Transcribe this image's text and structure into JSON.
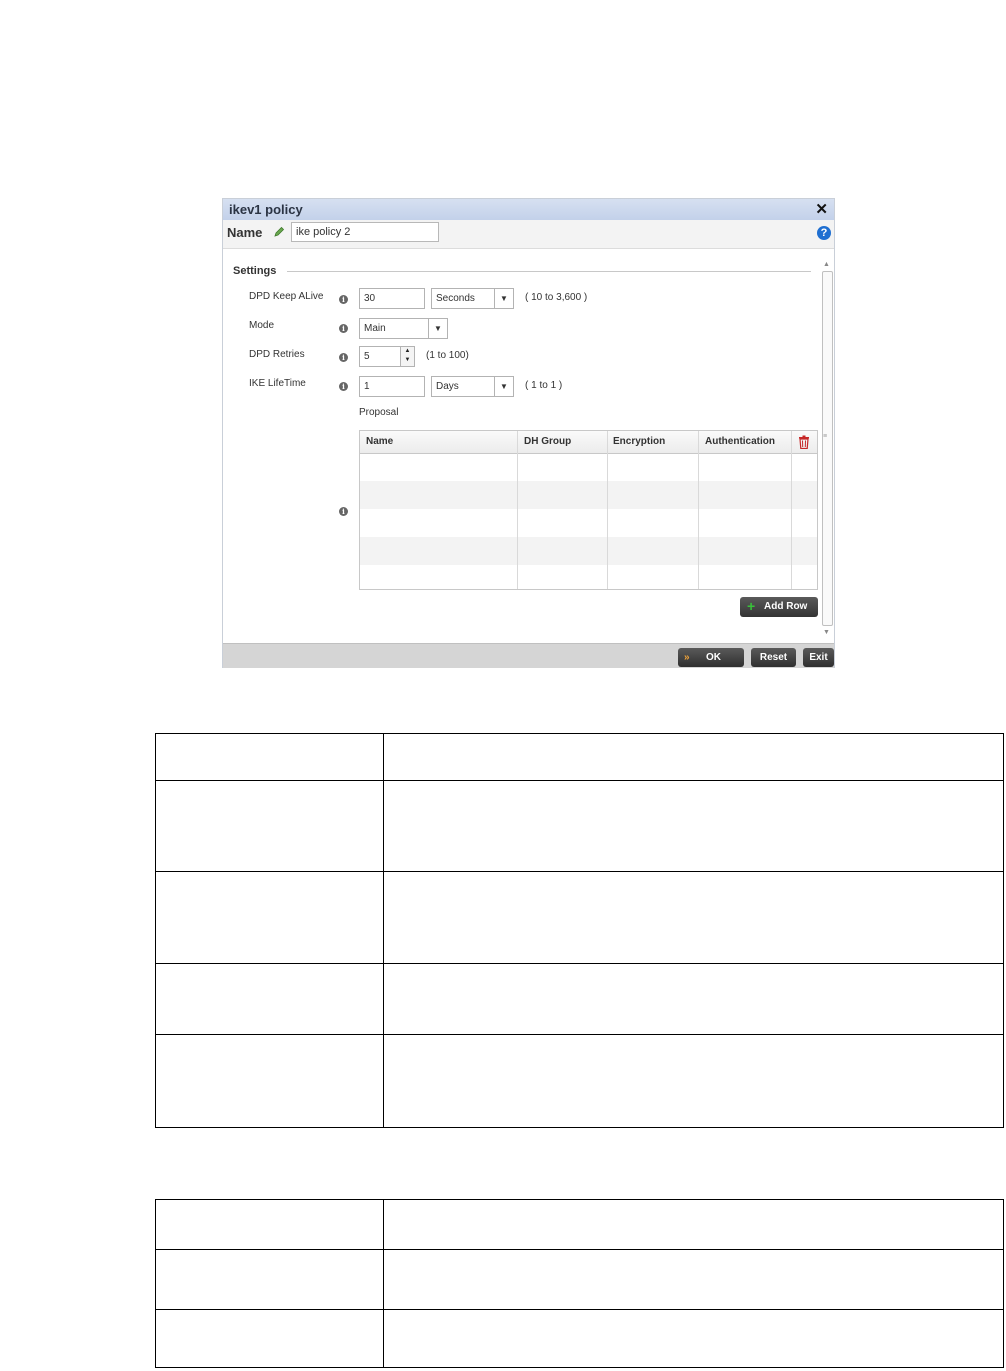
{
  "dialog": {
    "title": "ikev1 policy",
    "name_label": "Name",
    "name_value": "ike policy 2",
    "help_glyph": "?",
    "settings_title": "Settings",
    "fields": {
      "dpd_keepalive": {
        "label": "DPD Keep ALive",
        "value": "30",
        "unit": "Seconds",
        "range": "( 10 to 3,600 )"
      },
      "mode": {
        "label": "Mode",
        "value": "Main"
      },
      "dpd_retries": {
        "label": "DPD Retries",
        "value": "5",
        "range": "(1 to 100)"
      },
      "ike_lifetime": {
        "label": "IKE LifeTime",
        "value": "1",
        "unit": "Days",
        "range": "( 1 to 1 )"
      }
    },
    "proposal": {
      "label": "Proposal",
      "columns": [
        "Name",
        "DH Group",
        "Encryption",
        "Authentication"
      ]
    },
    "add_row_label": "Add Row",
    "buttons": {
      "ok": "OK",
      "reset": "Reset",
      "exit": "Exit"
    },
    "colors": {
      "accent": "#1f6fd1",
      "titlebar": "#cdd9ee",
      "button_dark": "#3c3c3c",
      "add_green": "#39c13a",
      "trash_red": "#c62828"
    }
  }
}
